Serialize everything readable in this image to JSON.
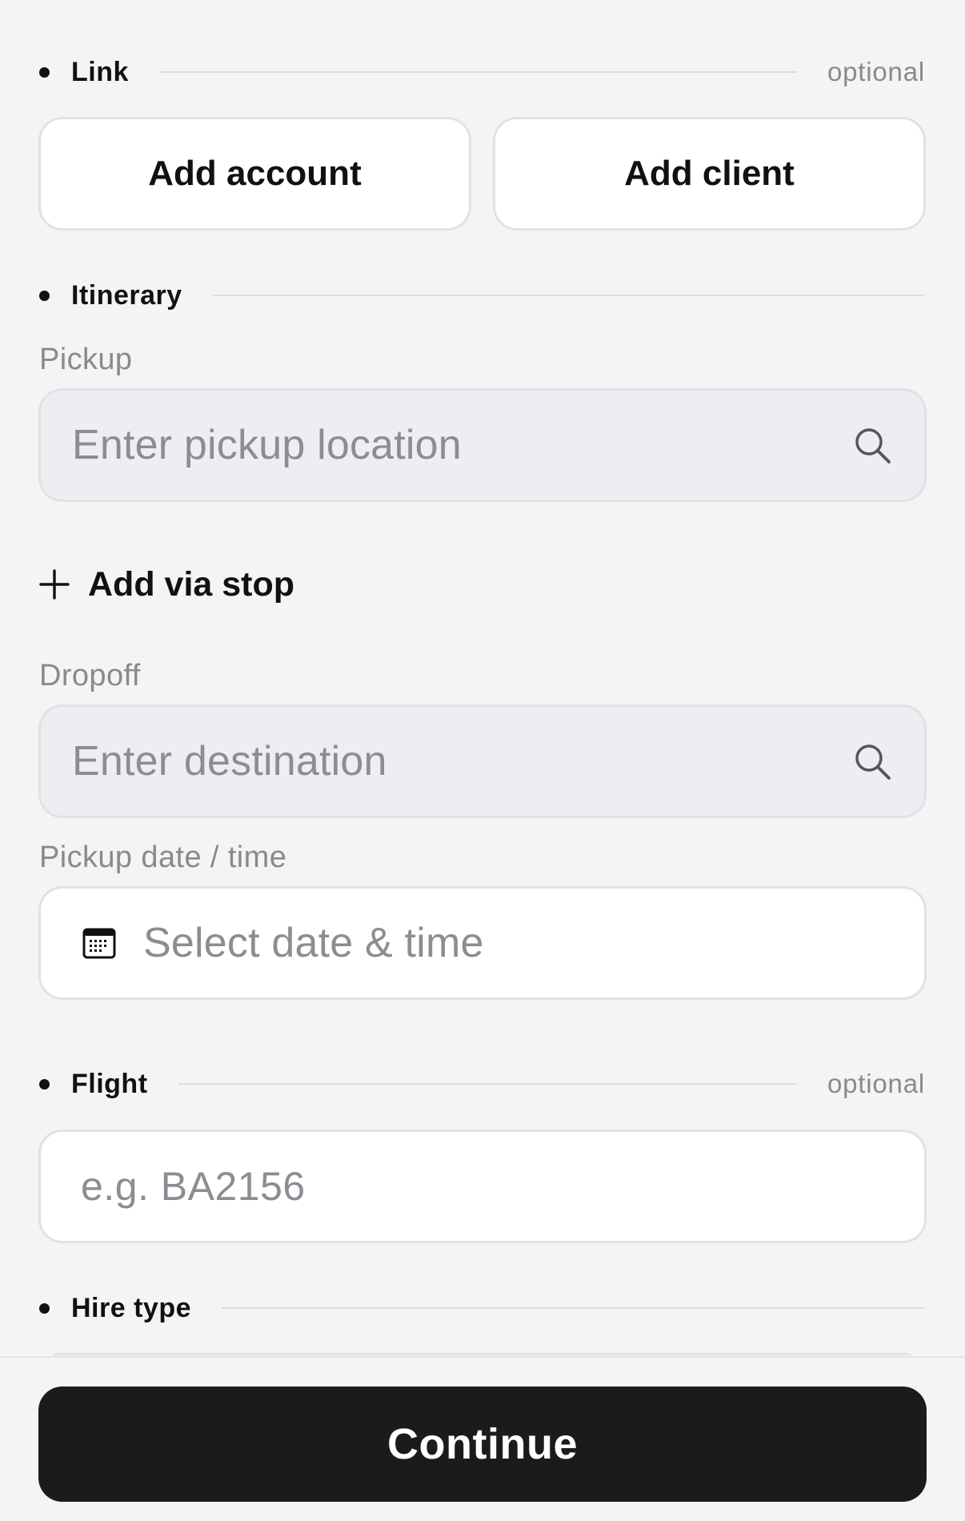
{
  "link_section": {
    "title": "Link",
    "optional_label": "optional",
    "add_account_label": "Add account",
    "add_client_label": "Add client"
  },
  "itinerary_section": {
    "title": "Itinerary",
    "pickup": {
      "label": "Pickup",
      "placeholder": "Enter pickup location",
      "icon": "search-icon"
    },
    "add_via_stop_label": "Add via stop",
    "dropoff": {
      "label": "Dropoff",
      "placeholder": "Enter destination",
      "icon": "search-icon"
    },
    "pickup_datetime": {
      "label": "Pickup date / time",
      "placeholder": "Select date & time",
      "icon": "calendar-icon"
    }
  },
  "flight_section": {
    "title": "Flight",
    "optional_label": "optional",
    "placeholder": "e.g. BA2156"
  },
  "hire_type_section": {
    "title": "Hire type"
  },
  "footer": {
    "continue_label": "Continue"
  },
  "colors": {
    "background": "#f4f4f5",
    "primary_button": "#1b1b1d",
    "search_field_fill": "#ededf2",
    "placeholder_text": "#8c8c92",
    "muted_label": "#8a8a8e"
  }
}
